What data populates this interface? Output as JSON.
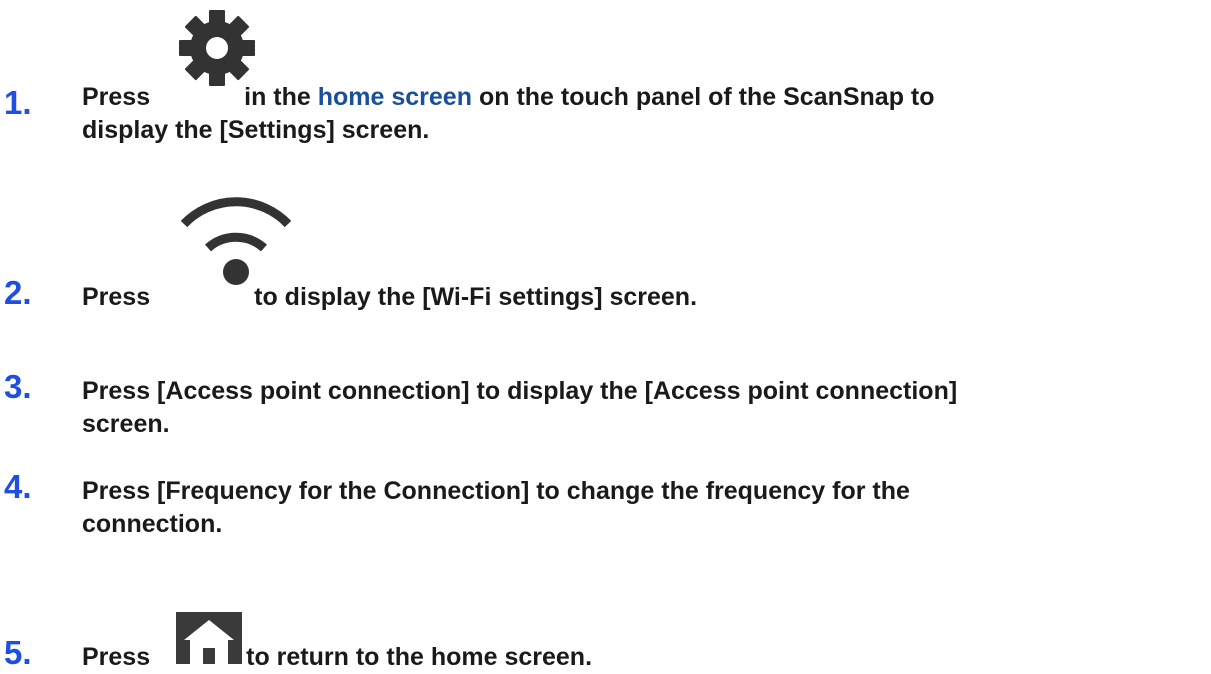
{
  "steps": [
    {
      "number": "1.",
      "parts": [
        "Press",
        "in the",
        "home screen",
        "on the touch panel of the ScanSnap to",
        "display the [Settings] screen."
      ],
      "icon": "gear-icon"
    },
    {
      "number": "2.",
      "parts": [
        "Press",
        "to display the [Wi-Fi settings] screen."
      ],
      "icon": "wifi-icon"
    },
    {
      "number": "3.",
      "lines": [
        "Press [Access point connection] to display the [Access point connection]",
        "screen."
      ]
    },
    {
      "number": "4.",
      "lines": [
        "Press [Frequency for the Connection] to change the frequency for the",
        "connection."
      ]
    },
    {
      "number": "5.",
      "parts": [
        "Press",
        "to return to the home screen."
      ],
      "icon": "home-icon"
    }
  ],
  "colors": {
    "step_number": "#1f4fe0",
    "link": "#1a4f9a",
    "text": "#1a1a1a",
    "icon": "#333333"
  }
}
